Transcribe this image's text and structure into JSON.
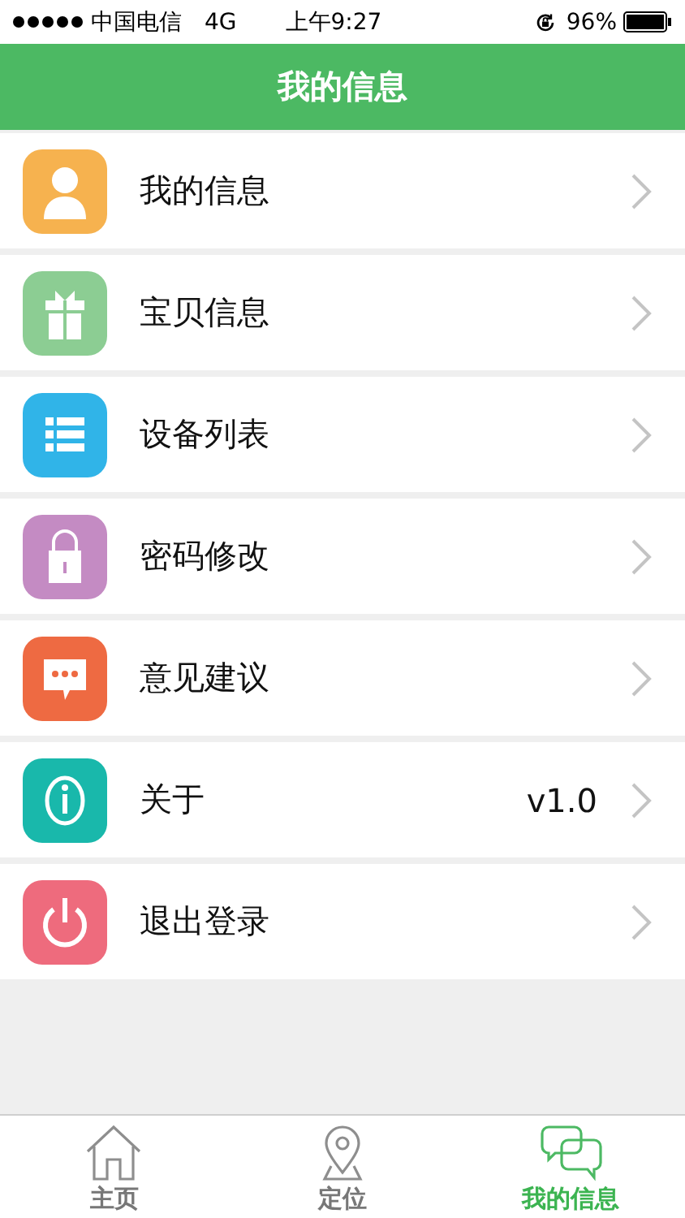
{
  "status_bar": {
    "carrier": "中国电信",
    "network": "4G",
    "time": "上午9:27",
    "battery": "96%"
  },
  "header": {
    "title": "我的信息"
  },
  "menu": [
    {
      "label": "我的信息",
      "kind": "person",
      "color": "#f6b24f"
    },
    {
      "label": "宝贝信息",
      "kind": "gift",
      "color": "#8ccd93"
    },
    {
      "label": "设备列表",
      "kind": "list",
      "color": "#30b4e8"
    },
    {
      "label": "密码修改",
      "kind": "lock",
      "color": "#c48bc3"
    },
    {
      "label": "意见建议",
      "kind": "chat",
      "color": "#ee6a42"
    },
    {
      "label": "关于",
      "kind": "info",
      "color": "#19b8ab",
      "value": "v1.0"
    },
    {
      "label": "退出登录",
      "kind": "power",
      "color": "#ee6b7d"
    }
  ],
  "tabs": [
    {
      "label": "主页",
      "kind": "home",
      "selected": false
    },
    {
      "label": "定位",
      "kind": "pin",
      "selected": false
    },
    {
      "label": "我的信息",
      "kind": "chat",
      "selected": true
    }
  ]
}
